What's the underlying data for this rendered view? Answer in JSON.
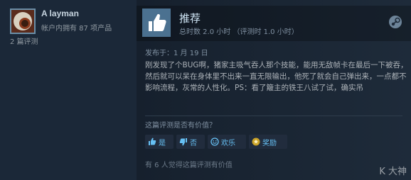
{
  "user": {
    "name": "A layman",
    "products_owned": "帐户内拥有 87 项产品",
    "review_count": "2 篇评测"
  },
  "review": {
    "recommendation": "推荐",
    "hours": "总时数 2.0 小时 （评测时 1.0 小时）",
    "posted": "发布于：1 月 19 日",
    "body": "刚发现了个BUG啊，猪家主吸气吞人那个技能，能用无敌帧卡在最后一下被吞，然后就可以呆在身体里不出来一直无限输出，他死了就会自己弹出来，一点都不影响流程，灰常的人性化。PS：看了簸主的铁王八试了试，确实吊"
  },
  "feedback": {
    "question": "这篇评测是否有价值？",
    "yes_label": "是",
    "no_label": "否",
    "funny_label": "欢乐",
    "award_label": "奖励",
    "helpful_count": "有 6 人觉得这篇评测有价值"
  },
  "watermark": "K 大神",
  "colors": {
    "background": "#1b2838",
    "accent": "#66c0f4",
    "thumb_box": "#4b7190"
  },
  "icons": [
    "thumbs-up-icon",
    "steam-logo-icon",
    "thumbs-down-icon",
    "funny-face-icon",
    "award-icon"
  ]
}
